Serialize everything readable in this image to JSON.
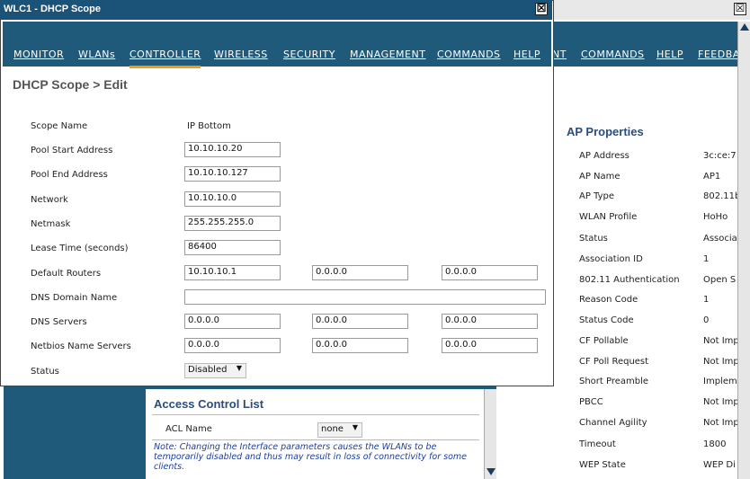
{
  "window": {
    "title": "WLC1 - DHCP Scope",
    "close_glyph": "☒"
  },
  "nav": {
    "items": [
      "MONITOR",
      "WLANs",
      "CONTROLLER",
      "WIRELESS",
      "SECURITY",
      "MANAGEMENT",
      "COMMANDS",
      "HELP"
    ],
    "background_items": [
      "NT",
      "COMMANDS",
      "HELP",
      "FEEDBA"
    ],
    "active": "CONTROLLER"
  },
  "form": {
    "breadcrumb": "DHCP Scope > Edit",
    "fields": {
      "scope_name": {
        "label": "Scope Name",
        "value": "IP Bottom"
      },
      "pool_start": {
        "label": "Pool Start Address",
        "value": "10.10.10.20"
      },
      "pool_end": {
        "label": "Pool End Address",
        "value": "10.10.10.127"
      },
      "network": {
        "label": "Network",
        "value": "10.10.10.0"
      },
      "netmask": {
        "label": "Netmask",
        "value": "255.255.255.0"
      },
      "lease": {
        "label": "Lease Time (seconds)",
        "value": "86400"
      },
      "routers": {
        "label": "Default Routers",
        "values": [
          "10.10.10.1",
          "0.0.0.0",
          "0.0.0.0"
        ]
      },
      "dns_domain": {
        "label": "DNS Domain Name",
        "value": ""
      },
      "dns_servers": {
        "label": "DNS Servers",
        "values": [
          "0.0.0.0",
          "0.0.0.0",
          "0.0.0.0"
        ]
      },
      "netbios": {
        "label": "Netbios Name Servers",
        "values": [
          "0.0.0.0",
          "0.0.0.0",
          "0.0.0.0"
        ]
      },
      "status": {
        "label": "Status",
        "value": "Disabled"
      }
    }
  },
  "acl": {
    "title": "Access Control List",
    "name_label": "ACL Name",
    "name_value": "none",
    "note": "Note: Changing the Interface parameters causes the WLANs to be temporarily disabled and thus may result in loss of connectivity for some clients."
  },
  "ap": {
    "title": "AP Properties",
    "rows": [
      {
        "label": "AP Address",
        "value": "3c:ce:7"
      },
      {
        "label": "AP Name",
        "value": "AP1"
      },
      {
        "label": "AP Type",
        "value": "802.11b"
      },
      {
        "label": "WLAN Profile",
        "value": "HoHo"
      },
      {
        "label": "Status",
        "value": "Associa"
      },
      {
        "label": "Association ID",
        "value": "1"
      },
      {
        "label": "802.11 Authentication",
        "value": "Open S"
      },
      {
        "label": "Reason Code",
        "value": "1"
      },
      {
        "label": "Status Code",
        "value": "0"
      },
      {
        "label": "CF Pollable",
        "value": "Not Imp"
      },
      {
        "label": "CF Poll Request",
        "value": "Not Imp"
      },
      {
        "label": "Short Preamble",
        "value": "Implem"
      },
      {
        "label": "PBCC",
        "value": "Not Imp"
      },
      {
        "label": "Channel Agility",
        "value": "Not Imp"
      },
      {
        "label": "Timeout",
        "value": "1800"
      },
      {
        "label": "WEP State",
        "value": "WEP Di"
      }
    ]
  },
  "colors": {
    "titlebar": "#1a5278",
    "nav": "#1f5a7a",
    "active_underline": "#f29a1a",
    "heading": "#2a4d7a",
    "note": "#1b3fa0"
  }
}
